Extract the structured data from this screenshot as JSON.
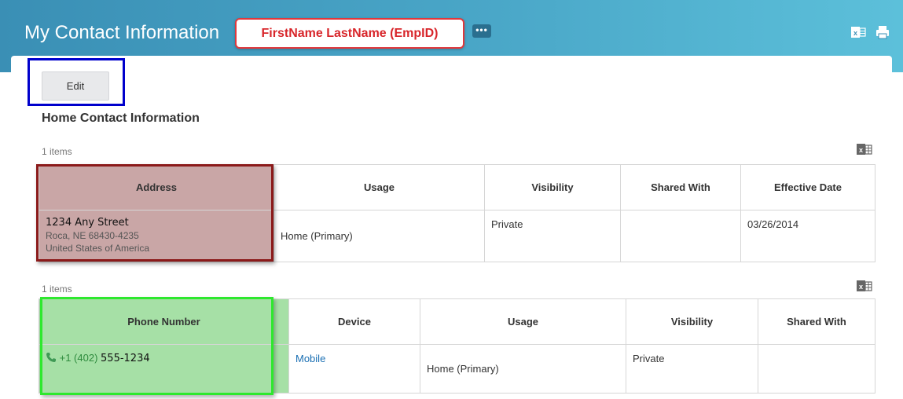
{
  "header": {
    "title": "My Contact Information",
    "worker_name": "FirstName LastName (EmpID)",
    "more_label": "•••",
    "icons": [
      "excel-export-icon",
      "print-icon"
    ]
  },
  "toolbar": {
    "edit_label": "Edit"
  },
  "home_contact": {
    "title": "Home Contact Information",
    "address_section": {
      "count_label": "1 items",
      "columns": [
        "Address",
        "Usage",
        "Visibility",
        "Shared With",
        "Effective Date"
      ],
      "rows": [
        {
          "address_line1": "1234 Any Street",
          "address_line2": "Roca, NE 68430-4235",
          "address_line3": "United States of America",
          "usage": "Home (Primary)",
          "visibility": "Private",
          "shared_with": "",
          "effective_date": "03/26/2014"
        }
      ]
    },
    "phone_section": {
      "count_label": "1 items",
      "columns": [
        "Phone Number",
        "Device",
        "Usage",
        "Visibility",
        "Shared With"
      ],
      "rows": [
        {
          "phone_prefix": "+1 (402) ",
          "phone_suffix": "555-1234",
          "device": "Mobile",
          "usage": "Home (Primary)",
          "visibility": "Private",
          "shared_with": ""
        }
      ]
    }
  },
  "colors": {
    "header_gradient_start": "#3a8fb5",
    "header_gradient_end": "#5cc0da",
    "name_callout_border": "#e0383c",
    "edit_highlight": "#0000cc",
    "address_highlight": "#8b1a1a",
    "phone_highlight": "#2ee82e"
  }
}
